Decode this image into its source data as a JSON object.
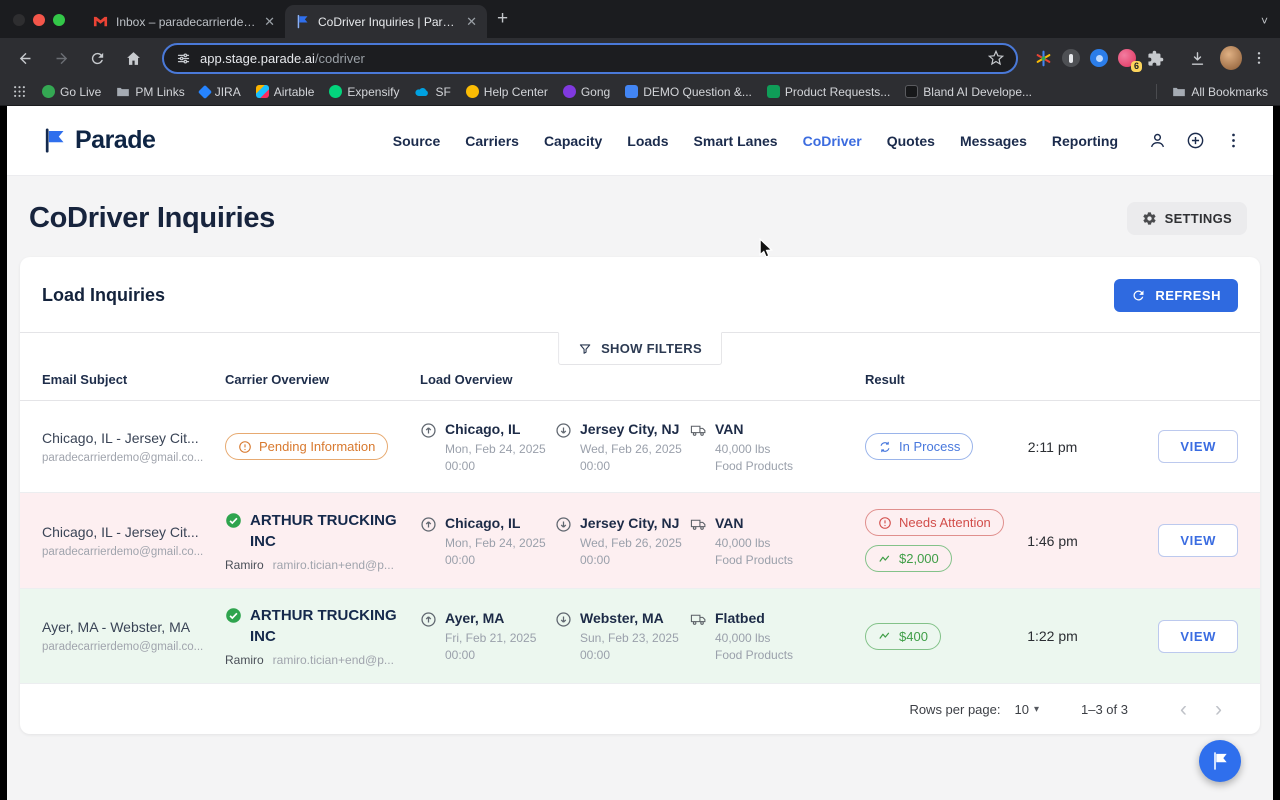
{
  "browser": {
    "tabs": [
      {
        "title": "Inbox – paradecarrierdemo@",
        "icon": "gmail-icon"
      },
      {
        "title": "CoDriver Inquiries | Parade",
        "icon": "parade-icon"
      }
    ],
    "url": {
      "domain": "app.stage.parade.ai",
      "path": "/codriver"
    },
    "extension_badge": "6",
    "bookmarks": [
      {
        "label": "Go Live"
      },
      {
        "label": "PM Links"
      },
      {
        "label": "JIRA"
      },
      {
        "label": "Airtable"
      },
      {
        "label": "Expensify"
      },
      {
        "label": "SF"
      },
      {
        "label": "Help Center"
      },
      {
        "label": "Gong"
      },
      {
        "label": "DEMO Question &..."
      },
      {
        "label": "Product Requests..."
      },
      {
        "label": "Bland AI Develope..."
      }
    ],
    "all_bookmarks_label": "All Bookmarks"
  },
  "app": {
    "brand": "Parade",
    "nav": [
      {
        "label": "Source"
      },
      {
        "label": "Carriers"
      },
      {
        "label": "Capacity"
      },
      {
        "label": "Loads"
      },
      {
        "label": "Smart Lanes"
      },
      {
        "label": "CoDriver",
        "active": true
      },
      {
        "label": "Quotes"
      },
      {
        "label": "Messages"
      },
      {
        "label": "Reporting"
      }
    ],
    "page_title": "CoDriver Inquiries",
    "settings_label": "SETTINGS",
    "panel": {
      "title": "Load Inquiries",
      "refresh_label": "REFRESH",
      "show_filters_label": "SHOW FILTERS"
    },
    "table": {
      "columns": {
        "email": "Email Subject",
        "carrier": "Carrier Overview",
        "load": "Load Overview",
        "result": "Result"
      },
      "rows": [
        {
          "subject": "Chicago, IL - Jersey Cit...",
          "email": "paradecarrierdemo@gmail.co...",
          "carrier_status": "Pending Information",
          "origin": {
            "city": "Chicago, IL",
            "date": "Mon, Feb 24, 2025",
            "time": "00:00"
          },
          "destination": {
            "city": "Jersey City, NJ",
            "date": "Wed, Feb 26, 2025",
            "time": "00:00"
          },
          "equipment": {
            "type": "VAN",
            "weight": "40,000 lbs",
            "commodity": "Food Products"
          },
          "status_pill": "In Process",
          "received_time": "2:11 pm",
          "view_label": "VIEW"
        },
        {
          "subject": "Chicago, IL - Jersey Cit...",
          "email": "paradecarrierdemo@gmail.co...",
          "carrier": {
            "name": "ARTHUR TRUCKING INC",
            "contact": "Ramiro",
            "contact_email": "ramiro.tician+end@p..."
          },
          "origin": {
            "city": "Chicago, IL",
            "date": "Mon, Feb 24, 2025",
            "time": "00:00"
          },
          "destination": {
            "city": "Jersey City, NJ",
            "date": "Wed, Feb 26, 2025",
            "time": "00:00"
          },
          "equipment": {
            "type": "VAN",
            "weight": "40,000 lbs",
            "commodity": "Food Products"
          },
          "attention_pill": "Needs Attention",
          "money_pill": "$2,000",
          "received_time": "1:46 pm",
          "view_label": "VIEW"
        },
        {
          "subject": "Ayer, MA - Webster, MA",
          "email": "paradecarrierdemo@gmail.co...",
          "carrier": {
            "name": "ARTHUR TRUCKING INC",
            "contact": "Ramiro",
            "contact_email": "ramiro.tician+end@p..."
          },
          "origin": {
            "city": "Ayer, MA",
            "date": "Fri, Feb 21, 2025",
            "time": "00:00"
          },
          "destination": {
            "city": "Webster, MA",
            "date": "Sun, Feb 23, 2025",
            "time": "00:00"
          },
          "equipment": {
            "type": "Flatbed",
            "weight": "40,000 lbs",
            "commodity": "Food Products"
          },
          "money_pill": "$400",
          "received_time": "1:22 pm",
          "view_label": "VIEW"
        }
      ]
    },
    "pagination": {
      "rows_per_page_label": "Rows per page:",
      "rows_per_page": "10",
      "range": "1–3 of 3"
    }
  },
  "colors": {
    "accent_blue": "#2f6ae0",
    "brand_navy": "#14294b",
    "pill_orange": "#d8792e",
    "pill_blue": "#4878dd",
    "pill_red": "#d24d4a",
    "pill_green": "#3f9e47",
    "row_pink": "#fdeff1",
    "row_green": "#ecf7ef"
  }
}
